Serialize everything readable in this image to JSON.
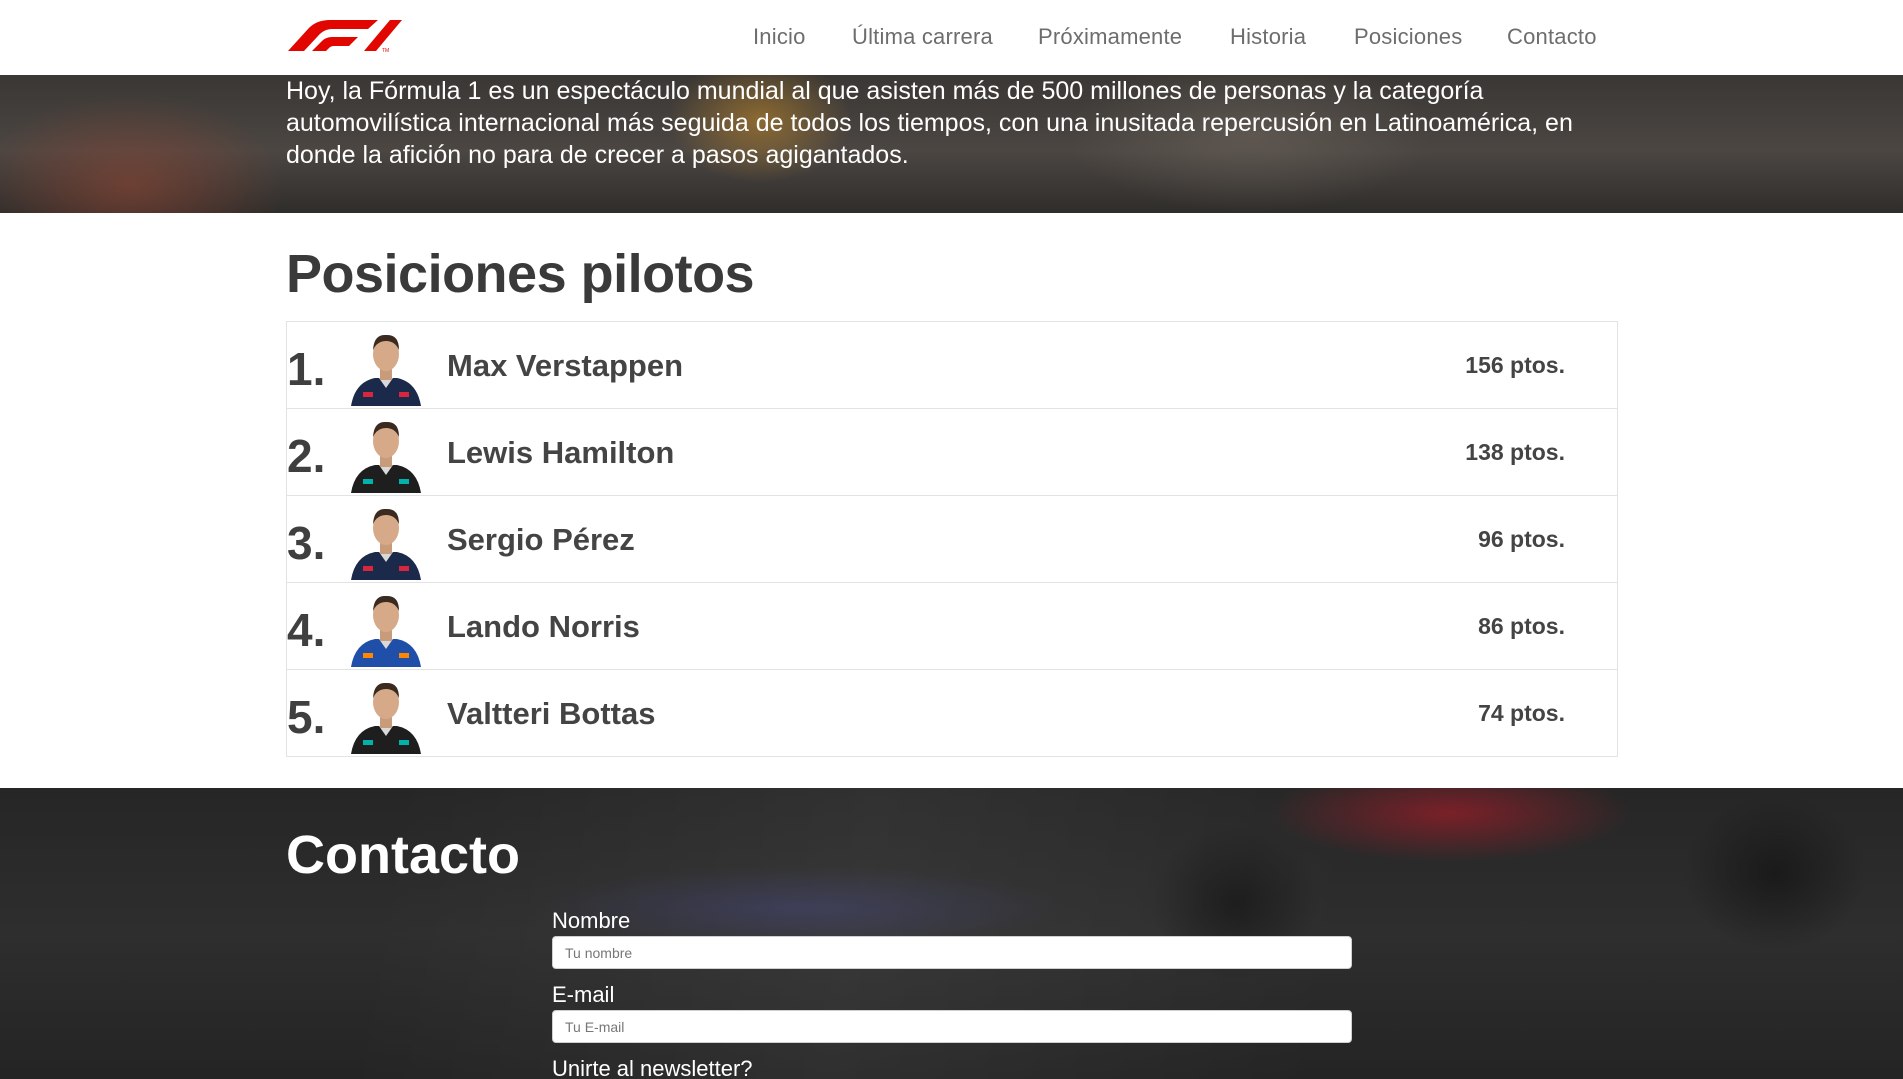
{
  "nav": {
    "items": [
      {
        "label": "Inicio"
      },
      {
        "label": "Última carrera"
      },
      {
        "label": "Próximamente"
      },
      {
        "label": "Historia"
      },
      {
        "label": "Posiciones"
      },
      {
        "label": "Contacto"
      }
    ],
    "brand_color": "#e10600"
  },
  "hero": {
    "text": "Hoy, la Fórmula 1 es un espectáculo mundial al que asisten más de 500 millones de personas y la categoría automovilística internacional más seguida de todos los tiempos, con una inusitada repercusión en Latinoamérica, en donde la afición no para de crecer a pasos agigantados."
  },
  "standings": {
    "title": "Posiciones pilotos",
    "rows": [
      {
        "position": "1.",
        "name": "Max Verstappen",
        "points": "156 ptos.",
        "suit_color": "#1b2a4a",
        "accent_color": "#d7263d"
      },
      {
        "position": "2.",
        "name": "Lewis Hamilton",
        "points": "138 ptos.",
        "suit_color": "#1e1e1e",
        "accent_color": "#00b2a9"
      },
      {
        "position": "3.",
        "name": "Sergio Pérez",
        "points": "96 ptos.",
        "suit_color": "#1b2a4a",
        "accent_color": "#d7263d"
      },
      {
        "position": "4.",
        "name": "Lando Norris",
        "points": "86 ptos.",
        "suit_color": "#1f4fa8",
        "accent_color": "#ff8700"
      },
      {
        "position": "5.",
        "name": "Valtteri Bottas",
        "points": "74 ptos.",
        "suit_color": "#1e1e1e",
        "accent_color": "#00b2a9"
      }
    ]
  },
  "contact": {
    "title": "Contacto",
    "name_label": "Nombre",
    "name_placeholder": "Tu nombre",
    "email_label": "E-mail",
    "email_placeholder": "Tu E-mail",
    "newsletter_label": "Unirte al newsletter?"
  }
}
